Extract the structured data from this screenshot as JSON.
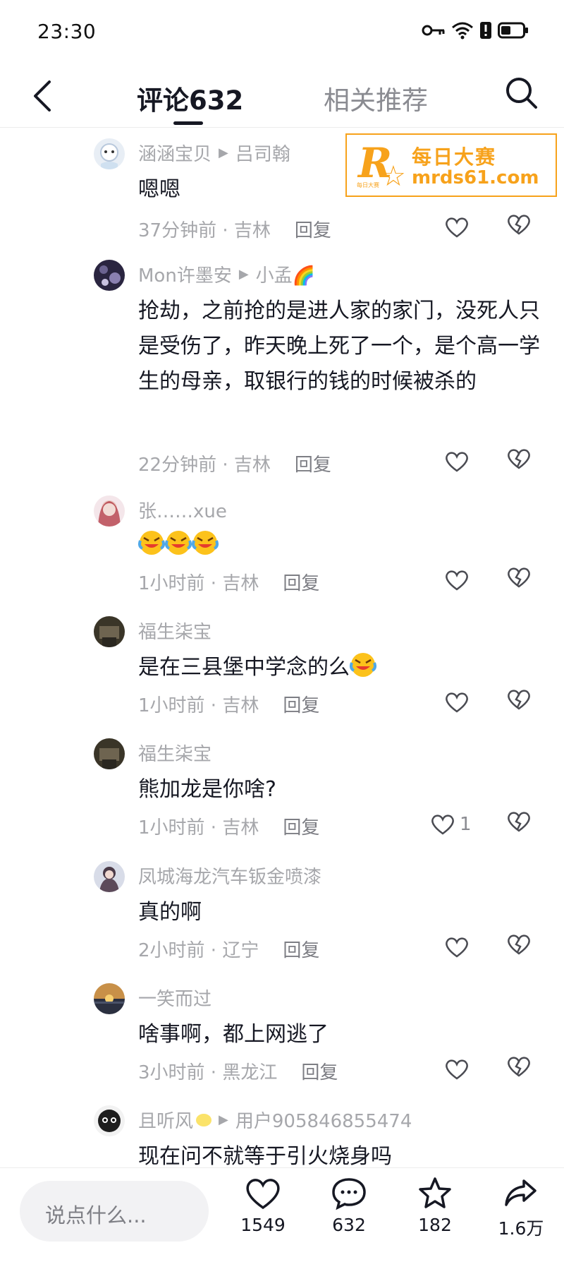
{
  "status_bar": {
    "time": "23:30"
  },
  "header": {
    "comments_tab": "评论632",
    "related_tab": "相关推荐"
  },
  "watermark": {
    "logo_letter": "R",
    "logo_small": "每日大赛",
    "brand_cn": "每日大赛",
    "brand_url": "mrds61.com"
  },
  "comments": [
    {
      "user": "涵涵宝贝",
      "reply_to": "吕司翰",
      "text": "嗯嗯",
      "time": "37分钟前",
      "location": "吉林",
      "reply": "回复",
      "likes": ""
    },
    {
      "user": "Mon许墨安",
      "reply_to": "小孟🌈",
      "text": "抢劫，之前抢的是进人家的家门，没死人只是受伤了，昨天晚上死了一个，是个高一学生的母亲，取银行的钱的时候被杀的",
      "time": "22分钟前",
      "location": "吉林",
      "reply": "回复",
      "likes": ""
    },
    {
      "user": "张……xue",
      "reply_to": "",
      "text": "",
      "time": "1小时前",
      "location": "吉林",
      "reply": "回复",
      "likes": ""
    },
    {
      "user": "福生柒宝",
      "reply_to": "",
      "text": "是在三县堡中学念的么",
      "time": "1小时前",
      "location": "吉林",
      "reply": "回复",
      "likes": ""
    },
    {
      "user": "福生柒宝",
      "reply_to": "",
      "text": "熊加龙是你啥?",
      "time": "1小时前",
      "location": "吉林",
      "reply": "回复",
      "likes": "1"
    },
    {
      "user": "凤城海龙汽车钣金喷漆",
      "reply_to": "",
      "text": "真的啊",
      "time": "2小时前",
      "location": "辽宁",
      "reply": "回复",
      "likes": ""
    },
    {
      "user": "一笑而过",
      "reply_to": "",
      "text": "啥事啊，都上网逃了",
      "time": "3小时前",
      "location": "黑龙江",
      "reply": "回复",
      "likes": ""
    },
    {
      "user": "且听风",
      "reply_to": "用户905846855474",
      "text": "现在问不就等于引火烧身吗",
      "time": "",
      "location": "",
      "reply": "",
      "likes": ""
    }
  ],
  "bottom_bar": {
    "input_placeholder": "说点什么...",
    "likes": "1549",
    "comments": "632",
    "favorites": "182",
    "shares": "1.6万"
  },
  "colors": {
    "text_primary": "#161823",
    "text_secondary": "#a6a7ab",
    "watermark": "#f7a21b"
  }
}
